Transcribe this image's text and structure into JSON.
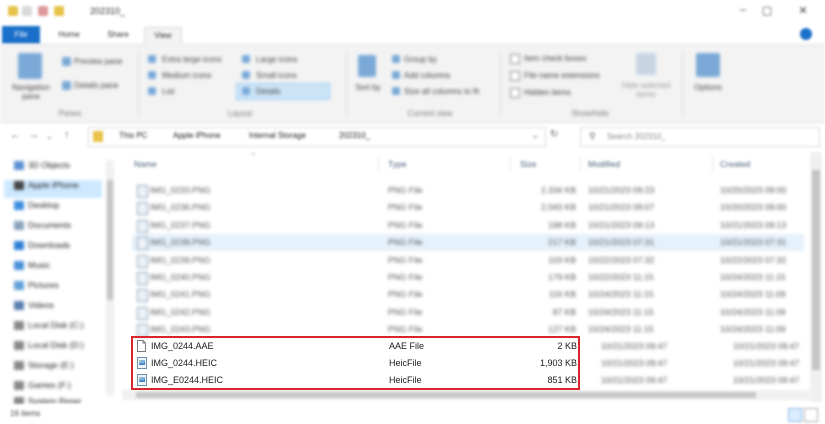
{
  "window": {
    "breadcrumb_short": "202310_"
  },
  "ribbon": {
    "tabs": [
      "File",
      "Home",
      "Share",
      "View"
    ],
    "panes": {
      "navigation_pane": "Navigation pane",
      "preview_pane": "Preview pane",
      "details_pane": "Details pane",
      "group_label": "Panes"
    },
    "layout": {
      "items": [
        "Extra large icons",
        "Large icons",
        "Medium icons",
        "Small icons",
        "List",
        "Details"
      ],
      "group_label": "Layout"
    },
    "current_view": {
      "sort_by": "Sort by",
      "group_by": "Group by",
      "add_columns": "Add columns",
      "size_all_columns": "Size all columns to fit",
      "group_label": "Current view"
    },
    "show_hide": {
      "item_check_boxes": "Item check boxes",
      "file_name_extensions": "File name extensions",
      "hidden_items": "Hidden items",
      "hide_selected": "Hide selected items",
      "group_label": "Show/hide"
    },
    "options": "Options"
  },
  "address": {
    "crumbs": [
      "This PC",
      "Apple iPhone",
      "Internal Storage",
      "202310_"
    ],
    "search_placeholder": "Search 202310_"
  },
  "nav_pane": {
    "items": [
      "3D Objects",
      "Apple iPhone",
      "Desktop",
      "Documents",
      "Downloads",
      "Music",
      "Pictures",
      "Videos",
      "Local Disk (C:)",
      "Local Disk (D:)",
      "Storage (E:)",
      "Games (F:)",
      "System Reser"
    ]
  },
  "columns": {
    "name": "Name",
    "type": "Type",
    "size": "Size",
    "modified": "Modified",
    "created": "Created"
  },
  "files_blurred": [
    {
      "name": "IMG_0233.PNG",
      "type": "PNG File",
      "size": "2,334 KB",
      "modified": "10/21/2023 09:23",
      "created": "10/20/2023 09:00"
    },
    {
      "name": "IMG_0236.PNG",
      "type": "PNG File",
      "size": "2,043 KB",
      "modified": "10/21/2023 09:07",
      "created": "10/20/2023 09:00"
    },
    {
      "name": "IMG_0237.PNG",
      "type": "PNG File",
      "size": "198 KB",
      "modified": "10/21/2023 09:13",
      "created": "10/21/2023 09:13"
    },
    {
      "name": "IMG_0238.PNG",
      "type": "PNG File",
      "size": "217 KB",
      "modified": "10/21/2023 07:31",
      "created": "10/21/2023 07:31"
    },
    {
      "name": "IMG_0239.PNG",
      "type": "PNG File",
      "size": "103 KB",
      "modified": "10/22/2023 07:32",
      "created": "10/22/2023 07:32"
    },
    {
      "name": "IMG_0240.PNG",
      "type": "PNG File",
      "size": "179 KB",
      "modified": "10/22/2023 11:15",
      "created": "10/24/2023 11:15"
    },
    {
      "name": "IMG_0241.PNG",
      "type": "PNG File",
      "size": "116 KB",
      "modified": "10/24/2023 11:15",
      "created": "10/24/2023 11:09"
    },
    {
      "name": "IMG_0242.PNG",
      "type": "PNG File",
      "size": "87 KB",
      "modified": "10/24/2023 11:15",
      "created": "10/24/2023 11:09"
    },
    {
      "name": "IMG_0243.PNG",
      "type": "PNG File",
      "size": "127 KB",
      "modified": "10/24/2023 11:15",
      "created": "10/24/2023 11:09"
    }
  ],
  "files_highlighted": [
    {
      "name": "IMG_0244.AAE",
      "type": "AAE File",
      "size": "2 KB",
      "modified": "10/21/2023 09:47",
      "created": "10/21/2023 09:47",
      "icon": "blank-file-icon"
    },
    {
      "name": "IMG_0244.HEIC",
      "type": "HeicFile",
      "size": "1,903 KB",
      "modified": "10/21/2023 09:47",
      "created": "10/21/2023 09:47",
      "icon": "image-file-icon"
    },
    {
      "name": "IMG_E0244.HEIC",
      "type": "HeicFile",
      "size": "851 KB",
      "modified": "10/21/2023 09:47",
      "created": "10/21/2023 09:47",
      "icon": "image-file-icon"
    }
  ],
  "status": {
    "item_count": "16 items"
  },
  "colors": {
    "file_tab": "#1a6fc9",
    "highlight_border": "#d8262c",
    "selection": "#cde8ff"
  }
}
